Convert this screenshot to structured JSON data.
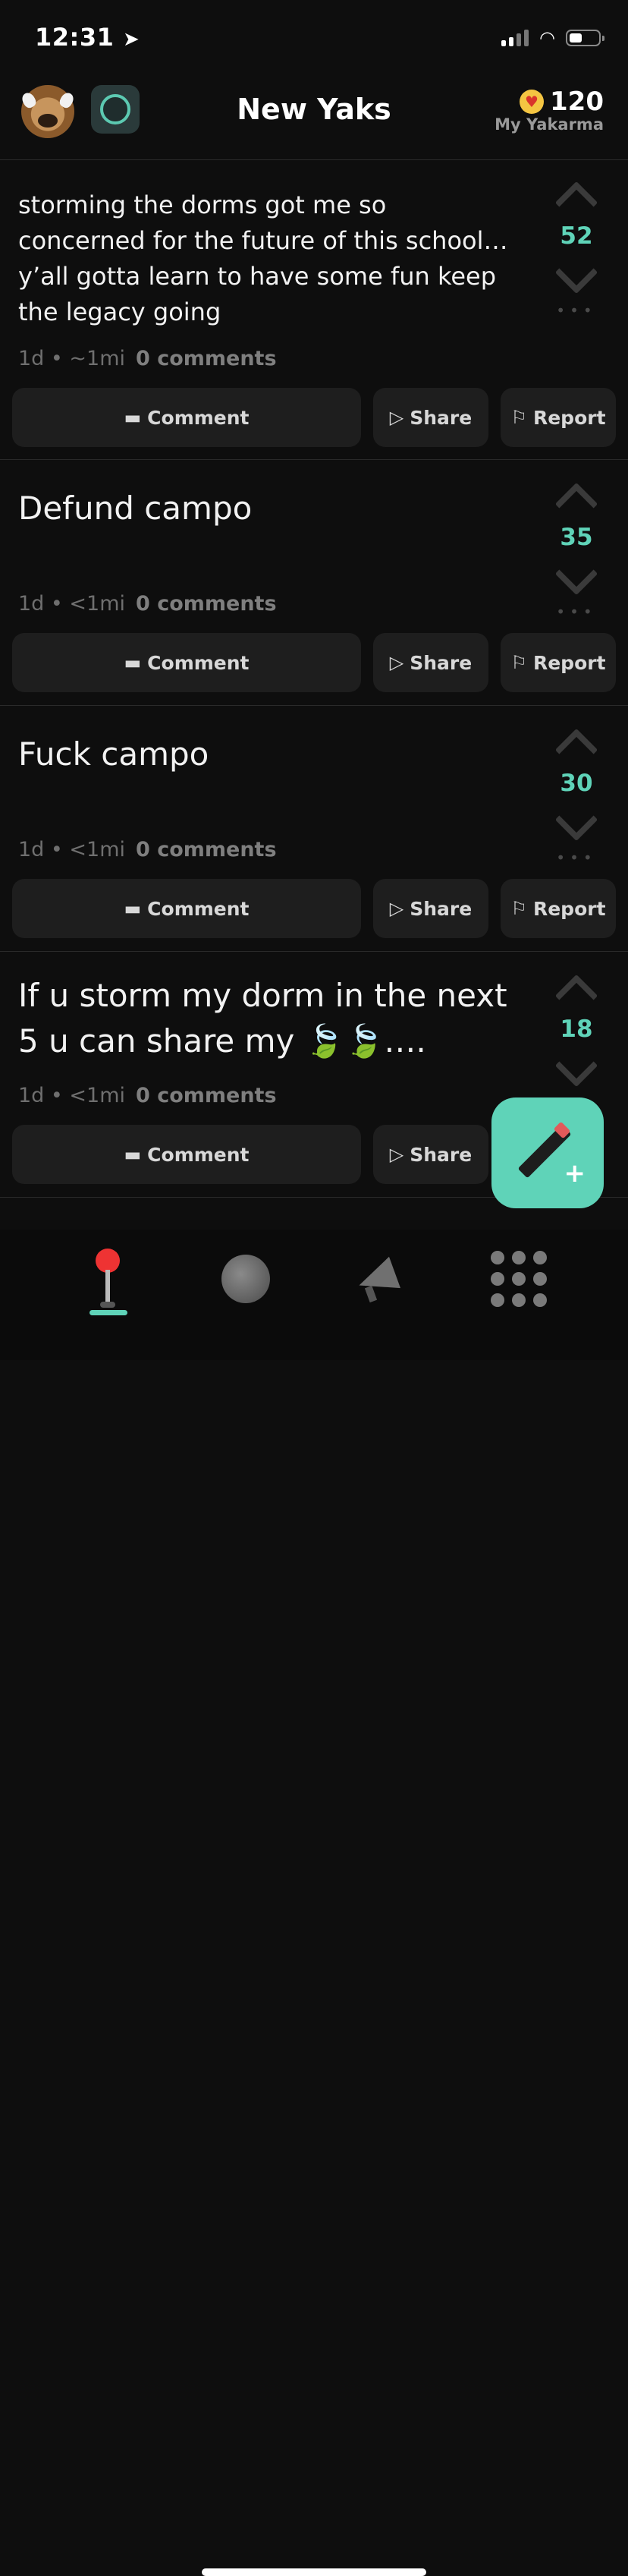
{
  "status": {
    "time": "12:31"
  },
  "header": {
    "title": "New Yaks",
    "yakarma_count": "120",
    "yakarma_label": "My Yakarma"
  },
  "buttons": {
    "comment": "Comment",
    "share": "Share",
    "report": "Report"
  },
  "posts": [
    {
      "text": "storming the dorms got me so concerned for the future of this school… y’all gotta learn to have some fun keep the legacy going",
      "votes": "52",
      "meta": "1d • ~1mi",
      "comments": "0 comments"
    },
    {
      "text": "Defund campo",
      "votes": "35",
      "meta": "1d • <1mi",
      "comments": "0 comments"
    },
    {
      "text": "Fuck campo",
      "votes": "30",
      "meta": "1d • <1mi",
      "comments": "0 comments"
    },
    {
      "text": "If u storm my dorm in the next 5 u can share my 🍃🍃….",
      "votes": "18",
      "meta": "1d • <1mi",
      "comments": "0 comments"
    }
  ],
  "colors": {
    "accent": "#5fd3b8",
    "background": "#0e0e0e",
    "card": "#1e1e1e"
  },
  "icons": [
    "location-arrow-icon",
    "wifi-icon",
    "heart-icon",
    "comment-icon",
    "share-icon",
    "report-flag-icon",
    "pencil-plus-icon",
    "joystick-icon",
    "globe-icon",
    "megaphone-icon",
    "grid-icon"
  ]
}
